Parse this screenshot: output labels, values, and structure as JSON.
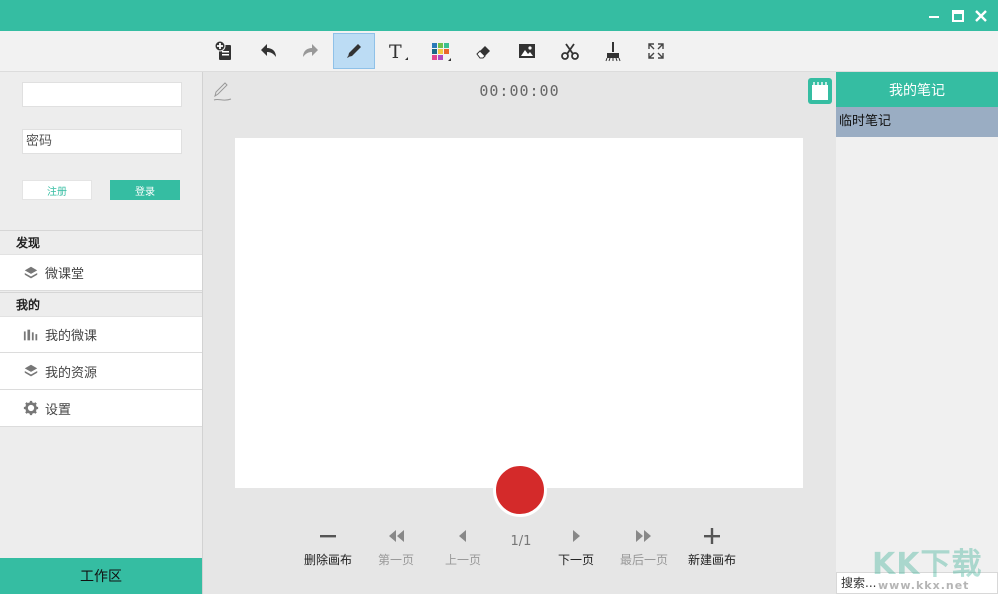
{
  "toolbar": {
    "tools": [
      {
        "name": "new-page",
        "icon": "add-document-icon"
      },
      {
        "name": "undo",
        "icon": "undo-icon"
      },
      {
        "name": "redo",
        "icon": "redo-icon"
      },
      {
        "name": "pen",
        "icon": "pen-icon",
        "active": true
      },
      {
        "name": "text",
        "icon": "text-icon",
        "glyph": "T"
      },
      {
        "name": "color",
        "icon": "color-palette-icon"
      },
      {
        "name": "eraser",
        "icon": "eraser-icon"
      },
      {
        "name": "image",
        "icon": "image-icon"
      },
      {
        "name": "cut",
        "icon": "scissors-icon"
      },
      {
        "name": "clear",
        "icon": "broom-icon"
      },
      {
        "name": "fullscreen",
        "icon": "fullscreen-icon"
      }
    ]
  },
  "login": {
    "username_value": "",
    "password_placeholder": "密码",
    "register_label": "注册",
    "login_label": "登录"
  },
  "sidebar": {
    "discover_title": "发现",
    "discover_items": [
      {
        "label": "微课堂",
        "icon": "cube-icon"
      }
    ],
    "mine_title": "我的",
    "mine_items": [
      {
        "label": "我的微课",
        "icon": "bar-chart-icon"
      },
      {
        "label": "我的资源",
        "icon": "layers-icon"
      },
      {
        "label": "设置",
        "icon": "gear-icon"
      }
    ],
    "workspace_label": "工作区"
  },
  "center": {
    "timer": "00:00:00",
    "page_indicator": "1/1",
    "controls": {
      "delete_canvas": "删除画布",
      "first_page": "第一页",
      "prev_page": "上一页",
      "next_page": "下一页",
      "last_page": "最后一页",
      "new_canvas": "新建画布"
    }
  },
  "notes": {
    "title": "我的笔记",
    "items": [
      "临时笔记"
    ],
    "search_placeholder": "搜索..."
  },
  "watermark": {
    "brand": "KK下载",
    "url": "www.kkx.net"
  },
  "colors": {
    "accent": "#35bda2",
    "record": "#d42a2a",
    "note_selected": "#9aadc3"
  }
}
